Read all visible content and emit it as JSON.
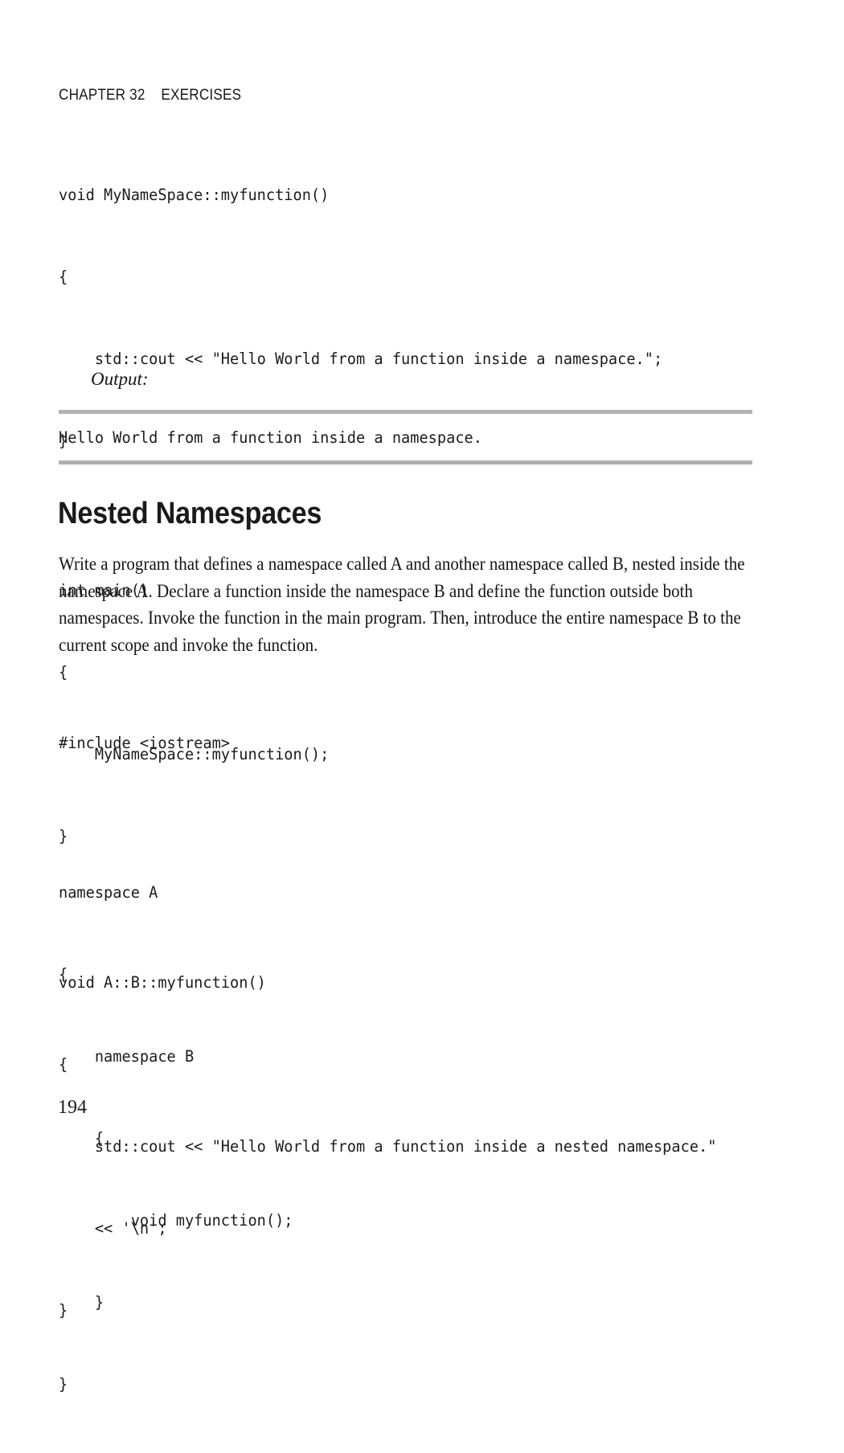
{
  "page": {
    "running_head": "CHAPTER 32    EXERCISES",
    "folio": "194",
    "background_color": "#ffffff",
    "text_color": "#1a1a1a",
    "rule_color": "#b3b3b3"
  },
  "code_block_1": {
    "lines": [
      "void MyNameSpace::myfunction()",
      "{",
      "    std::cout << \"Hello World from a function inside a namespace.\";",
      "}",
      "",
      "int main()",
      "{",
      "    MyNameSpace::myfunction();",
      "}"
    ],
    "l0": "void MyNameSpace::myfunction()",
    "l1": "{",
    "l2": "    std::cout << \"Hello World from a function inside a namespace.\";",
    "l3": "}",
    "l4": "",
    "l5": "int main()",
    "l6": "{",
    "l7": "    MyNameSpace::myfunction();",
    "l8": "}"
  },
  "output_section": {
    "label": "Output:",
    "text": "Hello World from a function inside a namespace."
  },
  "section": {
    "heading": "Nested Namespaces",
    "paragraph": "Write a program that defines a namespace called A and another namespace called B, nested inside the namespace A. Declare a function inside the namespace B and define the function outside both namespaces. Invoke the function in the main program. Then, introduce the entire namespace B to the current scope and invoke the function."
  },
  "code_block_2": {
    "lines": [
      "#include <iostream>",
      "",
      "namespace A",
      "{",
      "    namespace B",
      "    {",
      "        void myfunction();",
      "    }",
      "}"
    ],
    "l0": "#include <iostream>",
    "l1": "",
    "l2": "namespace A",
    "l3": "{",
    "l4": "    namespace B",
    "l5": "    {",
    "l6": "        void myfunction();",
    "l7": "    }",
    "l8": "}"
  },
  "code_block_3": {
    "lines": [
      "void A::B::myfunction()",
      "{",
      "    std::cout << \"Hello World from a function inside a nested namespace.\"",
      "    << '\\n';",
      "}"
    ],
    "l0": "void A::B::myfunction()",
    "l1": "{",
    "l2": "    std::cout << \"Hello World from a function inside a nested namespace.\"",
    "l3": "    << '\\n';",
    "l4": "}"
  }
}
